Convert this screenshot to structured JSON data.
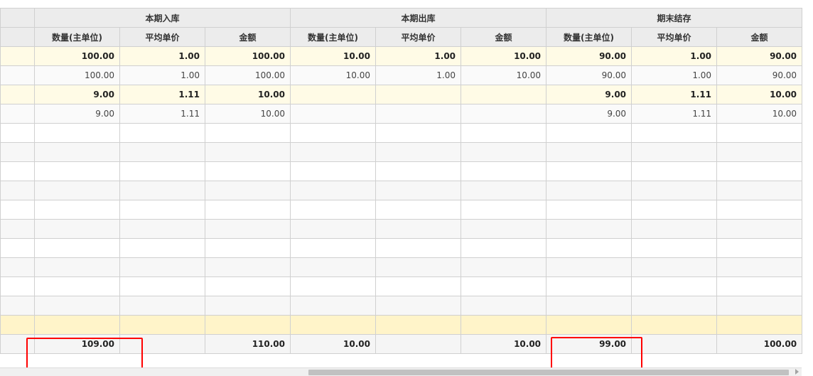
{
  "header": {
    "groups": [
      "本期入库",
      "本期出库",
      "期末结存"
    ],
    "columns": [
      "数量(主单位)",
      "平均单价",
      "金额",
      "数量(主单位)",
      "平均单价",
      "金额",
      "数量(主单位)",
      "平均单价",
      "金额"
    ]
  },
  "rows": {
    "r0": [
      "100.00",
      "1.00",
      "100.00",
      "10.00",
      "1.00",
      "10.00",
      "90.00",
      "1.00",
      "90.00"
    ],
    "r1": [
      "100.00",
      "1.00",
      "100.00",
      "10.00",
      "1.00",
      "10.00",
      "90.00",
      "1.00",
      "90.00"
    ],
    "r2": [
      "9.00",
      "1.11",
      "10.00",
      "",
      "",
      "",
      "9.00",
      "1.11",
      "10.00"
    ],
    "r3": [
      "9.00",
      "1.11",
      "10.00",
      "",
      "",
      "",
      "9.00",
      "1.11",
      "10.00"
    ]
  },
  "totals": [
    "109.00",
    "",
    "110.00",
    "10.00",
    "",
    "10.00",
    "99.00",
    "",
    "100.00"
  ],
  "colors": {
    "highlight_box": "#ff0000",
    "subtotal_row": "#fffbe6",
    "summary_band": "#fff4c9",
    "header_bg": "#ececec"
  }
}
